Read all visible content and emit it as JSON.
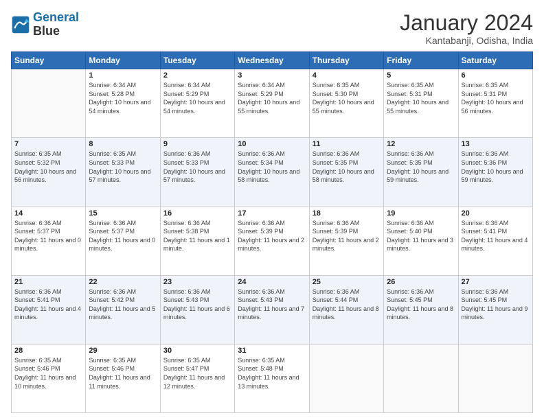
{
  "logo": {
    "line1": "General",
    "line2": "Blue"
  },
  "title": "January 2024",
  "location": "Kantabanji, Odisha, India",
  "weekdays": [
    "Sunday",
    "Monday",
    "Tuesday",
    "Wednesday",
    "Thursday",
    "Friday",
    "Saturday"
  ],
  "weeks": [
    [
      {
        "day": "",
        "sunrise": "",
        "sunset": "",
        "daylight": ""
      },
      {
        "day": "1",
        "sunrise": "6:34 AM",
        "sunset": "5:28 PM",
        "daylight": "10 hours and 54 minutes."
      },
      {
        "day": "2",
        "sunrise": "6:34 AM",
        "sunset": "5:29 PM",
        "daylight": "10 hours and 54 minutes."
      },
      {
        "day": "3",
        "sunrise": "6:34 AM",
        "sunset": "5:29 PM",
        "daylight": "10 hours and 55 minutes."
      },
      {
        "day": "4",
        "sunrise": "6:35 AM",
        "sunset": "5:30 PM",
        "daylight": "10 hours and 55 minutes."
      },
      {
        "day": "5",
        "sunrise": "6:35 AM",
        "sunset": "5:31 PM",
        "daylight": "10 hours and 55 minutes."
      },
      {
        "day": "6",
        "sunrise": "6:35 AM",
        "sunset": "5:31 PM",
        "daylight": "10 hours and 56 minutes."
      }
    ],
    [
      {
        "day": "7",
        "sunrise": "6:35 AM",
        "sunset": "5:32 PM",
        "daylight": "10 hours and 56 minutes."
      },
      {
        "day": "8",
        "sunrise": "6:35 AM",
        "sunset": "5:33 PM",
        "daylight": "10 hours and 57 minutes."
      },
      {
        "day": "9",
        "sunrise": "6:36 AM",
        "sunset": "5:33 PM",
        "daylight": "10 hours and 57 minutes."
      },
      {
        "day": "10",
        "sunrise": "6:36 AM",
        "sunset": "5:34 PM",
        "daylight": "10 hours and 58 minutes."
      },
      {
        "day": "11",
        "sunrise": "6:36 AM",
        "sunset": "5:35 PM",
        "daylight": "10 hours and 58 minutes."
      },
      {
        "day": "12",
        "sunrise": "6:36 AM",
        "sunset": "5:35 PM",
        "daylight": "10 hours and 59 minutes."
      },
      {
        "day": "13",
        "sunrise": "6:36 AM",
        "sunset": "5:36 PM",
        "daylight": "10 hours and 59 minutes."
      }
    ],
    [
      {
        "day": "14",
        "sunrise": "6:36 AM",
        "sunset": "5:37 PM",
        "daylight": "11 hours and 0 minutes."
      },
      {
        "day": "15",
        "sunrise": "6:36 AM",
        "sunset": "5:37 PM",
        "daylight": "11 hours and 0 minutes."
      },
      {
        "day": "16",
        "sunrise": "6:36 AM",
        "sunset": "5:38 PM",
        "daylight": "11 hours and 1 minute."
      },
      {
        "day": "17",
        "sunrise": "6:36 AM",
        "sunset": "5:39 PM",
        "daylight": "11 hours and 2 minutes."
      },
      {
        "day": "18",
        "sunrise": "6:36 AM",
        "sunset": "5:39 PM",
        "daylight": "11 hours and 2 minutes."
      },
      {
        "day": "19",
        "sunrise": "6:36 AM",
        "sunset": "5:40 PM",
        "daylight": "11 hours and 3 minutes."
      },
      {
        "day": "20",
        "sunrise": "6:36 AM",
        "sunset": "5:41 PM",
        "daylight": "11 hours and 4 minutes."
      }
    ],
    [
      {
        "day": "21",
        "sunrise": "6:36 AM",
        "sunset": "5:41 PM",
        "daylight": "11 hours and 4 minutes."
      },
      {
        "day": "22",
        "sunrise": "6:36 AM",
        "sunset": "5:42 PM",
        "daylight": "11 hours and 5 minutes."
      },
      {
        "day": "23",
        "sunrise": "6:36 AM",
        "sunset": "5:43 PM",
        "daylight": "11 hours and 6 minutes."
      },
      {
        "day": "24",
        "sunrise": "6:36 AM",
        "sunset": "5:43 PM",
        "daylight": "11 hours and 7 minutes."
      },
      {
        "day": "25",
        "sunrise": "6:36 AM",
        "sunset": "5:44 PM",
        "daylight": "11 hours and 8 minutes."
      },
      {
        "day": "26",
        "sunrise": "6:36 AM",
        "sunset": "5:45 PM",
        "daylight": "11 hours and 8 minutes."
      },
      {
        "day": "27",
        "sunrise": "6:36 AM",
        "sunset": "5:45 PM",
        "daylight": "11 hours and 9 minutes."
      }
    ],
    [
      {
        "day": "28",
        "sunrise": "6:35 AM",
        "sunset": "5:46 PM",
        "daylight": "11 hours and 10 minutes."
      },
      {
        "day": "29",
        "sunrise": "6:35 AM",
        "sunset": "5:46 PM",
        "daylight": "11 hours and 11 minutes."
      },
      {
        "day": "30",
        "sunrise": "6:35 AM",
        "sunset": "5:47 PM",
        "daylight": "11 hours and 12 minutes."
      },
      {
        "day": "31",
        "sunrise": "6:35 AM",
        "sunset": "5:48 PM",
        "daylight": "11 hours and 13 minutes."
      },
      {
        "day": "",
        "sunrise": "",
        "sunset": "",
        "daylight": ""
      },
      {
        "day": "",
        "sunrise": "",
        "sunset": "",
        "daylight": ""
      },
      {
        "day": "",
        "sunrise": "",
        "sunset": "",
        "daylight": ""
      }
    ]
  ]
}
